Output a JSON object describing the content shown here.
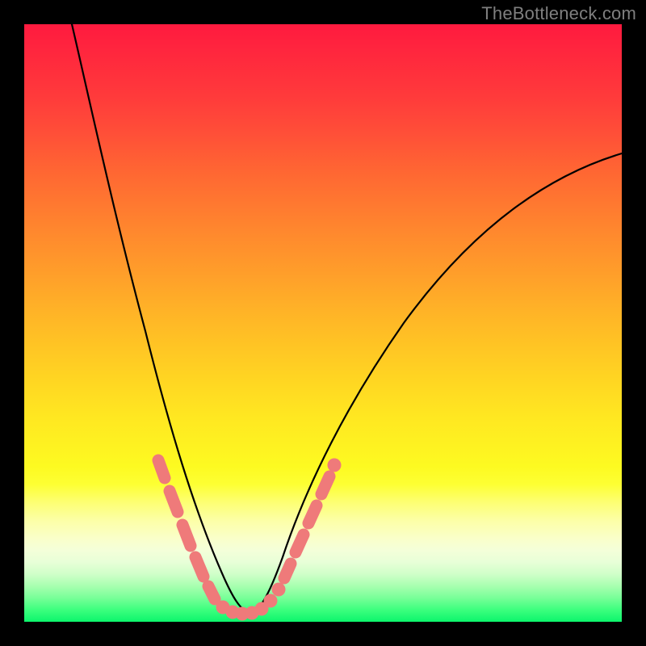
{
  "watermark": "TheBottleneck.com",
  "colors": {
    "bead": "#ef7a7a",
    "curve": "#000000",
    "frame": "#000000",
    "watermark": "#7f7f7f"
  },
  "chart_data": {
    "type": "line",
    "title": "",
    "xlabel": "",
    "ylabel": "",
    "xlim": [
      0,
      100
    ],
    "ylim": [
      0,
      100
    ],
    "grid": false,
    "legend": null,
    "gradient_stops": [
      {
        "pos": 0.0,
        "color": "#ff1a3f"
      },
      {
        "pos": 0.5,
        "color": "#ffc524"
      },
      {
        "pos": 0.75,
        "color": "#fdff33"
      },
      {
        "pos": 0.9,
        "color": "#d0ffc9"
      },
      {
        "pos": 1.0,
        "color": "#0cf56c"
      }
    ],
    "series": [
      {
        "name": "bottleneck-curve",
        "x": [
          8,
          10,
          12,
          14,
          16,
          18,
          20,
          22,
          24,
          26,
          28,
          30,
          32,
          33,
          34,
          35,
          36,
          38,
          40,
          42,
          44,
          46,
          50,
          55,
          60,
          65,
          70,
          75,
          80,
          85,
          90,
          95,
          100
        ],
        "y": [
          100,
          93,
          86,
          79,
          72,
          65,
          58,
          51,
          44,
          37,
          30,
          23,
          16,
          12,
          8,
          5,
          3,
          2,
          3,
          6,
          10,
          14,
          22,
          31,
          39,
          46,
          52,
          57,
          62,
          66,
          70,
          73,
          76
        ]
      }
    ],
    "bead_overlay": {
      "description": "salient pink bead markers along lower portion of curve",
      "left_arm_beads_x": [
        22.0,
        23.2,
        24.5,
        25.8,
        27.0,
        28.3,
        29.5,
        30.8,
        32.0
      ],
      "left_arm_beads_y": [
        28.0,
        25.5,
        23.0,
        20.5,
        18.0,
        15.5,
        13.0,
        10.5,
        8.0
      ],
      "valley_beads_x": [
        33.0,
        34.0,
        35.0,
        36.0,
        37.0,
        38.0,
        39.0,
        40.0,
        41.0,
        42.0
      ],
      "valley_beads_y": [
        5.0,
        3.5,
        2.5,
        2.0,
        2.0,
        2.5,
        3.5,
        5.0,
        7.0,
        9.0
      ],
      "right_arm_beads_x": [
        43.0,
        44.5,
        46.0,
        47.5,
        49.0,
        50.5
      ],
      "right_arm_beads_y": [
        11.5,
        14.5,
        17.5,
        20.5,
        23.5,
        26.5
      ]
    }
  }
}
